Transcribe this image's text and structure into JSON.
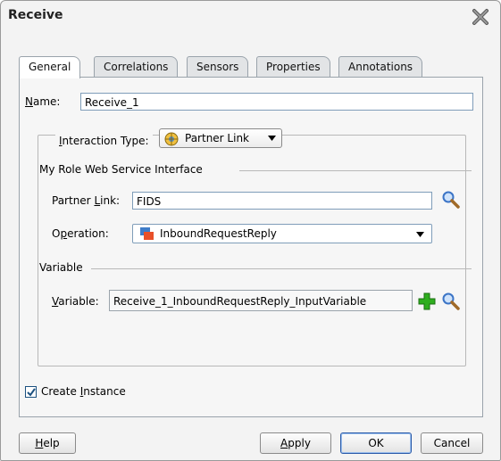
{
  "dialog": {
    "title": "Receive"
  },
  "tabs": [
    {
      "label": "General",
      "active": true
    },
    {
      "label": "Correlations"
    },
    {
      "label": "Sensors"
    },
    {
      "label": "Properties"
    },
    {
      "label": "Annotations"
    }
  ],
  "name": {
    "label_prefix": "",
    "label_u": "N",
    "label_rest": "ame:",
    "value": "Receive_1"
  },
  "interaction": {
    "label_u": "I",
    "label_rest": "nteraction Type:",
    "selected": "Partner Link"
  },
  "my_role": {
    "title": "My Role Web Service Interface"
  },
  "partner_link": {
    "label_pre": "Partner ",
    "label_u": "L",
    "label_rest": "ink:",
    "value": "FIDS"
  },
  "operation": {
    "label_pre": "O",
    "label_u": "p",
    "label_rest": "eration:",
    "value": "InboundRequestReply"
  },
  "variable_group": {
    "title": "Variable"
  },
  "variable": {
    "label_u": "V",
    "label_rest": "ariable:",
    "value": "Receive_1_InboundRequestReply_InputVariable"
  },
  "create_instance": {
    "label_pre": "Create ",
    "label_u": "I",
    "label_rest": "nstance",
    "checked": true
  },
  "buttons": {
    "help_u": "H",
    "help_rest": "elp",
    "apply_u": "A",
    "apply_rest": "pply",
    "ok": "OK",
    "cancel": "Cancel"
  },
  "colors": {
    "add_green": "#2fae1f",
    "search_blue": "#3b74c6"
  }
}
